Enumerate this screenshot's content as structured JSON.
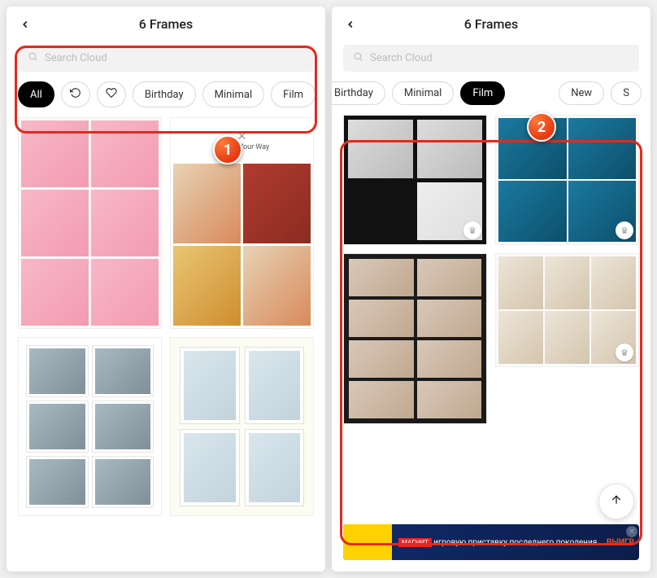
{
  "left": {
    "title": "6 Frames",
    "search_placeholder": "Search Cloud",
    "chips": {
      "all": "All",
      "birthday": "Birthday",
      "minimal": "Minimal",
      "film": "Film"
    },
    "template_b_caption": "Have It Your Way",
    "badge": "1"
  },
  "right": {
    "title": "6 Frames",
    "search_placeholder": "Search Cloud",
    "chips": {
      "birthday": "Birthday",
      "minimal": "Minimal",
      "film": "Film",
      "new": "New",
      "s": "S"
    },
    "badge": "2",
    "ad": {
      "brand": "МАГНИТ",
      "headline": "ВЫИГР",
      "sub": "игровую приставку последнего поколения"
    }
  }
}
